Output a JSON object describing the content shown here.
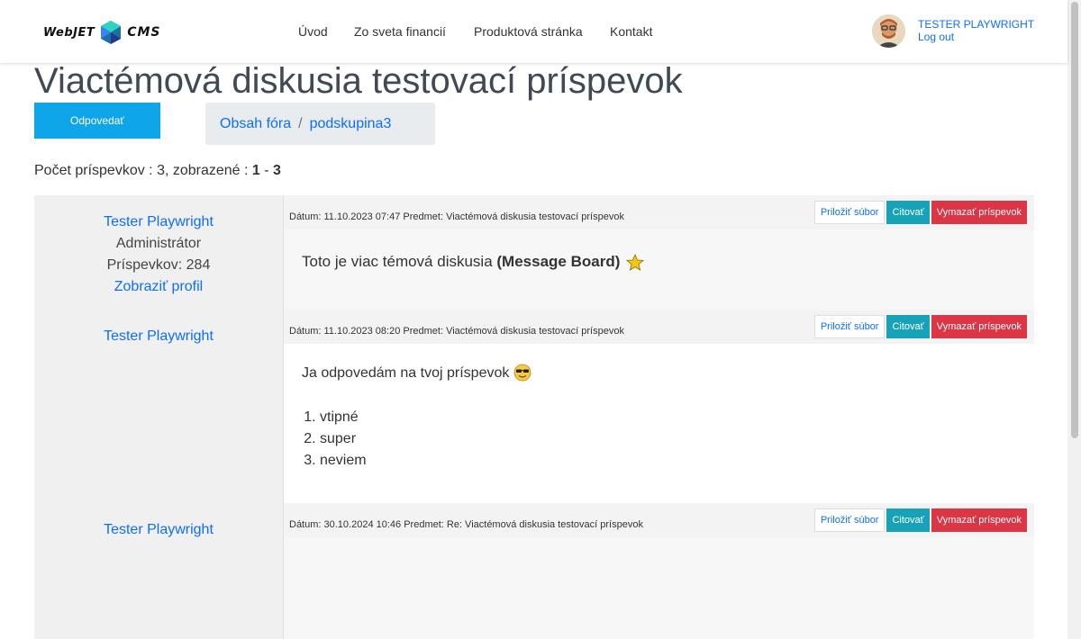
{
  "header": {
    "logo_left": "WebJET",
    "logo_right": "CMS",
    "nav": [
      "Úvod",
      "Zo sveta financií",
      "Produktová stránka",
      "Kontakt"
    ],
    "user_name": "TESTER PLAYWRIGHT",
    "logout": "Log out"
  },
  "page": {
    "title": "Viactémová diskusia testovací príspevok",
    "reply_button": "Odpovedať",
    "breadcrumb": [
      "Obsah fóra",
      "podskupina3"
    ],
    "count_prefix": "Počet príspevkov : 3, zobrazené : ",
    "count_from": "1",
    "count_dash": " - ",
    "count_to": "3"
  },
  "actions": {
    "attach": "Priložiť súbor",
    "quote": "Citovať",
    "delete": "Vymazať príspevok"
  },
  "posts": [
    {
      "author": "Tester Playwright",
      "role": "Administrátor",
      "posts_count": "Príspevkov: 284",
      "profile_link": "Zobraziť profil",
      "meta": "Dátum: 11.10.2023 07:47 Predmet: Viactémová diskusia testovací príspevok",
      "text_plain": "Toto je viac témová diskusia ",
      "text_bold": "(Message Board)",
      "emoji": "star-icon"
    },
    {
      "author": "Tester Playwright",
      "meta": "Dátum: 11.10.2023 08:20 Predmet: Viactémová diskusia testovací príspevok",
      "text_plain": "Ja odpovedám na tvoj príspevok ",
      "emoji": "sunglasses-emoji-icon",
      "list": [
        "vtipné",
        "super",
        "neviem"
      ]
    },
    {
      "author": "Tester Playwright",
      "meta": "Dátum: 30.10.2024 10:46 Predmet: Re: Viactémová diskusia testovací príspevok"
    }
  ]
}
